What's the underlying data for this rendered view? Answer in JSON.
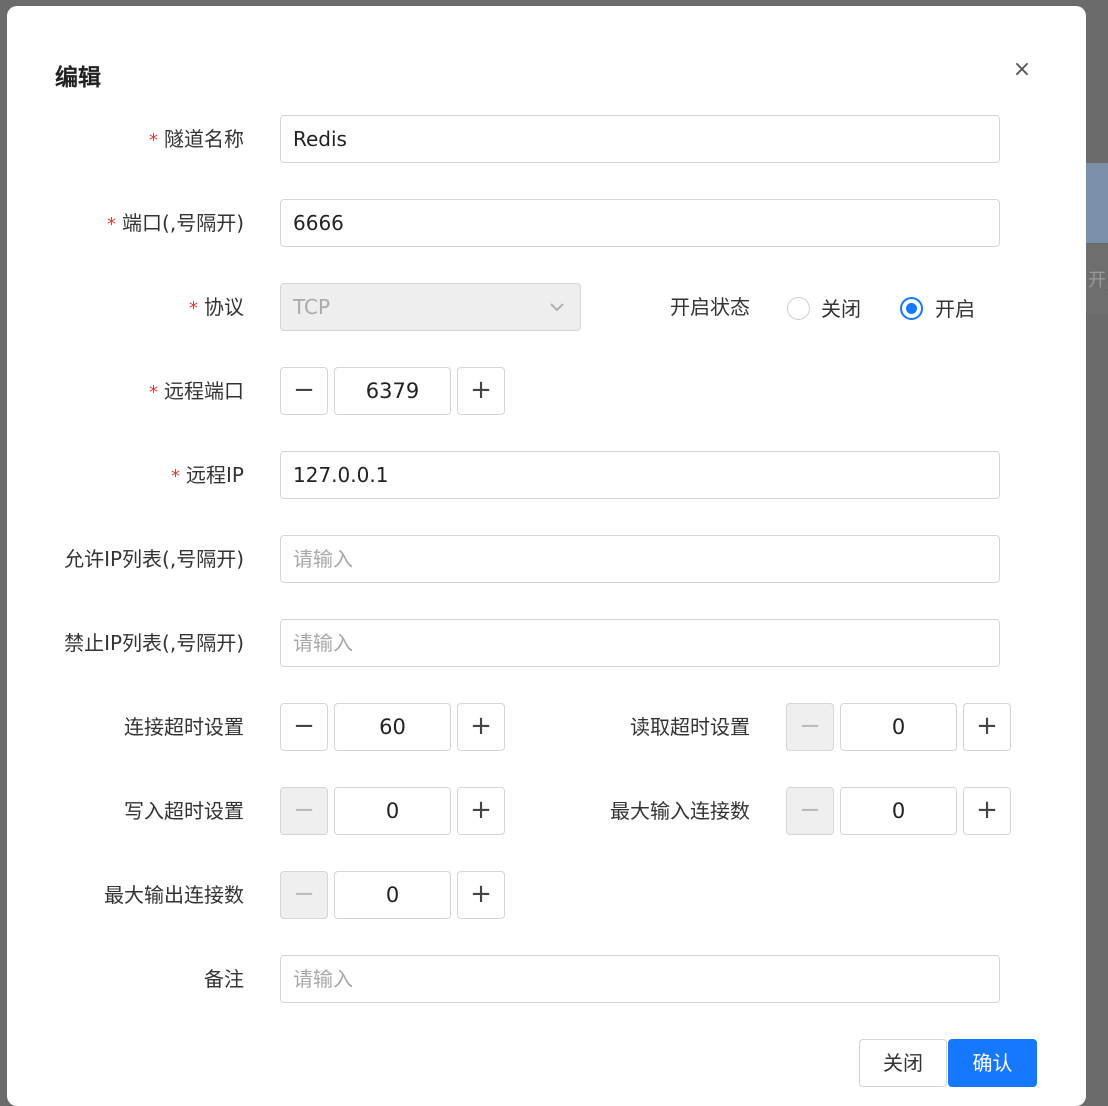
{
  "dialog": {
    "title": "编辑",
    "close_icon": "×"
  },
  "form": {
    "tunnel_name": {
      "label": "隧道名称",
      "value": "Redis",
      "required": true
    },
    "port": {
      "label": "端口(,号隔开)",
      "value": "6666",
      "required": true
    },
    "protocol": {
      "label": "协议",
      "value": "TCP",
      "required": true,
      "disabled": true
    },
    "status": {
      "label": "开启状态",
      "options": [
        {
          "label": "关闭",
          "checked": false
        },
        {
          "label": "开启",
          "checked": true
        }
      ]
    },
    "remote_port": {
      "label": "远程端口",
      "value": "6379",
      "required": true
    },
    "remote_ip": {
      "label": "远程IP",
      "value": "127.0.0.1",
      "required": true
    },
    "allow_ip_list": {
      "label": "允许IP列表(,号隔开)",
      "value": "",
      "placeholder": "请输入"
    },
    "deny_ip_list": {
      "label": "禁止IP列表(,号隔开)",
      "value": "",
      "placeholder": "请输入"
    },
    "connect_timeout": {
      "label": "连接超时设置",
      "value": "60"
    },
    "read_timeout": {
      "label": "读取超时设置",
      "value": "0"
    },
    "write_timeout": {
      "label": "写入超时设置",
      "value": "0"
    },
    "max_in_connections": {
      "label": "最大输入连接数",
      "value": "0"
    },
    "max_out_connections": {
      "label": "最大输出连接数",
      "value": "0"
    },
    "remark": {
      "label": "备注",
      "value": "",
      "placeholder": "请输入"
    }
  },
  "stepper": {
    "minus": "−",
    "plus": "+"
  },
  "footer": {
    "cancel_label": "关闭",
    "confirm_label": "确认"
  },
  "background": {
    "partial_text": "开)"
  },
  "colors": {
    "primary": "#1677ff",
    "required": "#e0382f",
    "overlay": "#6b6b6b"
  }
}
